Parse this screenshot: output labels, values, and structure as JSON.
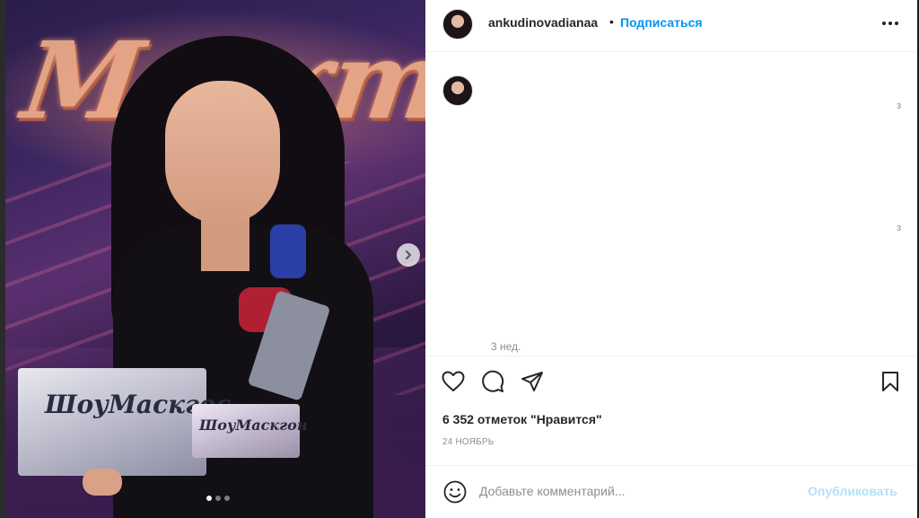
{
  "post": {
    "photo": {
      "sign_text": "Маскто",
      "trophy_large_text": "ШоуМаскгос",
      "trophy_small_text": "ШоуМаскгон",
      "carousel": {
        "total": 3,
        "active": 1
      }
    },
    "header": {
      "username": "ankudinovadianaa",
      "separator": "•",
      "follow_label": "Подписаться"
    },
    "comments": {
      "edge_marks": [
        "з",
        "з"
      ],
      "time_ago": "3 нед."
    },
    "actions": {
      "icons": [
        "heart-icon",
        "comment-icon",
        "share-icon",
        "bookmark-icon"
      ]
    },
    "likes_text": "6 352 отметок \"Нравится\"",
    "date_text": "24 НОЯБРЬ",
    "comment_box": {
      "placeholder": "Добавьте комментарий...",
      "publish_label": "Опубликовать"
    },
    "colors": {
      "accent": "#0095f6",
      "publish_disabled": "#b2dffc",
      "muted_text": "#8e8e8e",
      "divider": "#efefef"
    }
  }
}
